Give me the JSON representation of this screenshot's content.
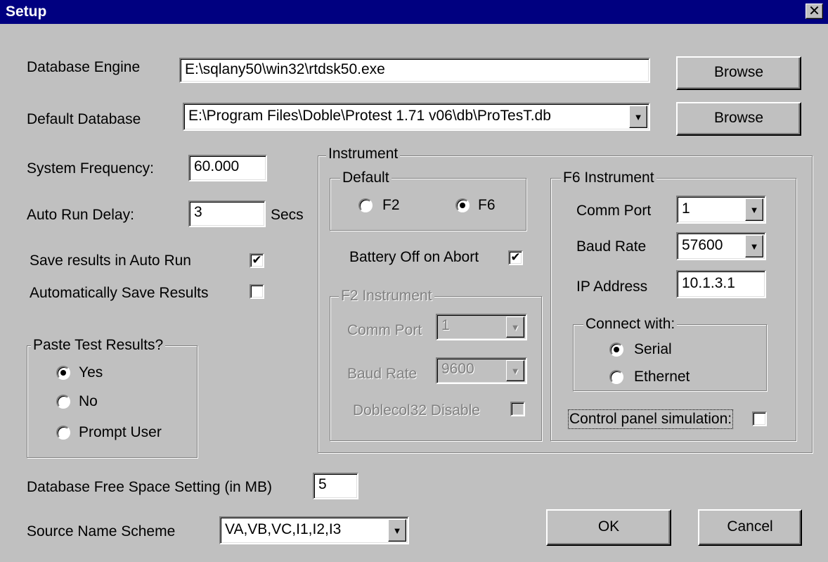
{
  "window": {
    "title": "Setup",
    "close_glyph": "✕"
  },
  "database_engine": {
    "label": "Database Engine",
    "value": "E:\\sqlany50\\win32\\rtdsk50.exe",
    "browse": "Browse"
  },
  "default_database": {
    "label": "Default Database",
    "value": "E:\\Program Files\\Doble\\Protest 1.71 v06\\db\\ProTesT.db",
    "browse": "Browse"
  },
  "system_frequency": {
    "label": "System Frequency:",
    "value": "60.000"
  },
  "auto_run_delay": {
    "label": "Auto Run Delay:",
    "value": "3",
    "unit": "Secs"
  },
  "save_results_auto_run": {
    "label": "Save results in Auto Run",
    "checked": true
  },
  "auto_save_results": {
    "label": "Automatically Save Results",
    "checked": false
  },
  "paste_results": {
    "label": "Paste Test Results?",
    "options": [
      "Yes",
      "No",
      "Prompt User"
    ],
    "selected": "Yes"
  },
  "instrument": {
    "label": "Instrument",
    "default": {
      "label": "Default",
      "options": [
        "F2",
        "F6"
      ],
      "selected": "F6"
    },
    "battery_off": {
      "label": "Battery Off on Abort",
      "checked": true
    },
    "f2": {
      "label": "F2 Instrument",
      "comm_port": {
        "label": "Comm Port",
        "value": "1"
      },
      "baud_rate": {
        "label": "Baud Rate",
        "value": "9600"
      },
      "doblecol": {
        "label": "Doblecol32 Disable",
        "checked": false
      }
    },
    "f6": {
      "label": "F6 Instrument",
      "comm_port": {
        "label": "Comm Port",
        "value": "1"
      },
      "baud_rate": {
        "label": "Baud Rate",
        "value": "57600"
      },
      "ip_address": {
        "label": "IP Address",
        "value": "10.1.3.1"
      },
      "connect_with": {
        "label": "Connect with:",
        "options": [
          "Serial",
          "Ethernet"
        ],
        "selected": "Serial"
      },
      "control_panel": {
        "label": "Control panel simulation:",
        "checked": false
      }
    }
  },
  "free_space": {
    "label": "Database Free Space Setting (in MB)",
    "value": "5"
  },
  "source_name": {
    "label": "Source Name Scheme",
    "value": "VA,VB,VC,I1,I2,I3"
  },
  "buttons": {
    "ok": "OK",
    "cancel": "Cancel"
  },
  "glyphs": {
    "check": "✔",
    "arrow": "▼"
  },
  "icons": {
    "dropdown": "chevron-down-icon",
    "close": "close-icon",
    "check": "check-icon"
  }
}
